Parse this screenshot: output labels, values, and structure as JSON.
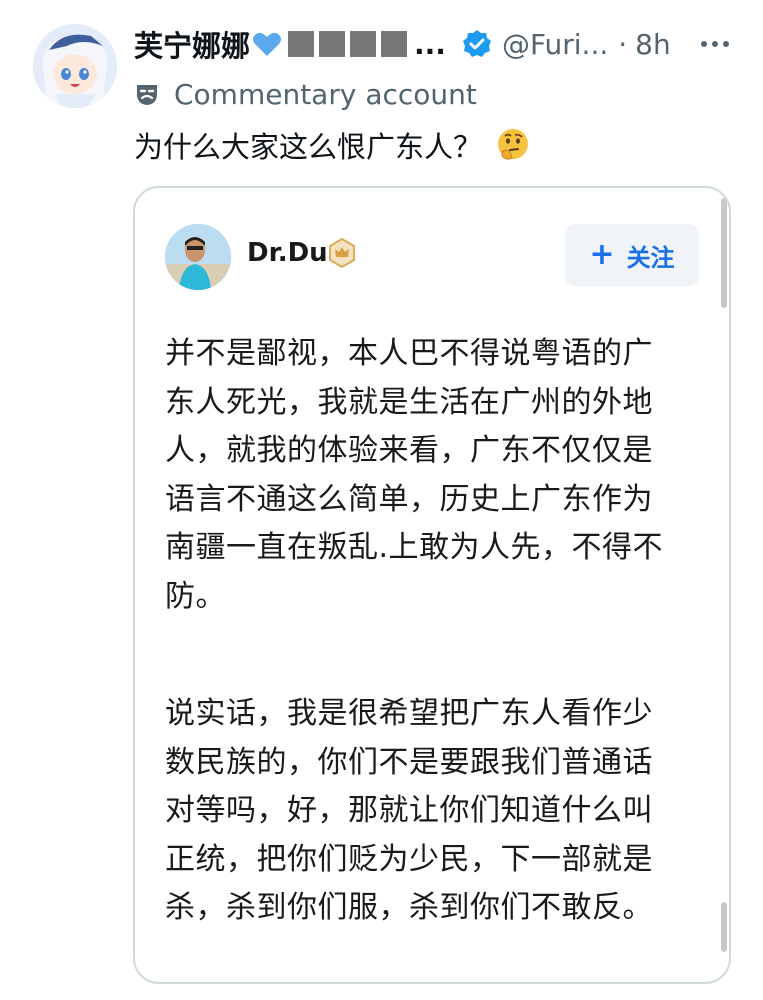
{
  "tweet": {
    "display_name": "芙宁娜娜",
    "name_suffix": "...",
    "handle": "@Furi...",
    "dot": "·",
    "time": "8h",
    "account_label": "Commentary account",
    "text": "为什么大家这么恨广东人？",
    "emoji": "thinking-face-icon"
  },
  "quoted_post": {
    "author": "Dr.Du",
    "follow_label": "关注",
    "follow_icon": "+",
    "paragraph1_lines": [
      "并不是鄙视，本人巴不得说粤语的广",
      "东人死光，我就是生活在广州的外地",
      "人，就我的体验来看，广东不仅仅是",
      "语言不通这么简单，历史上广东作为",
      "南疆一直在叛乱.上敢为人先，不得不",
      "防。"
    ],
    "paragraph2_lines": [
      "说实话，我是很希望把广东人看作少",
      "数民族的，你们不是要跟我们普通话",
      "对等吗，好，那就让你们知道什么叫",
      "正统，把你们贬为少民，下一部就是",
      "杀，杀到你们服，杀到你们不敢反。"
    ]
  },
  "colors": {
    "accent_blue": "#1d9bf0",
    "follow_blue": "#1a6fe8",
    "secondary_text": "#536471",
    "redaction": "#777777"
  }
}
